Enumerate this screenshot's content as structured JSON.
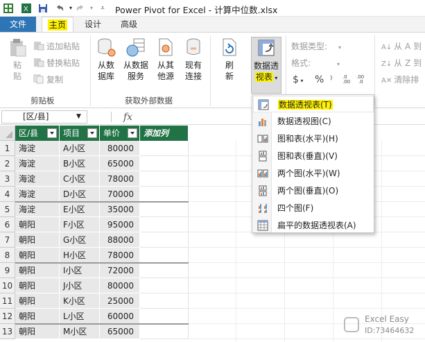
{
  "window": {
    "title": "Power Pivot for Excel - 计算中位数.xlsx"
  },
  "ribbon_tabs": [
    {
      "label": "文件"
    },
    {
      "label": "主页"
    },
    {
      "label": "设计"
    },
    {
      "label": "高级"
    }
  ],
  "clipboard_group": {
    "paste_line1": "粘",
    "paste_line2": "贴",
    "append_paste": "追加粘贴",
    "replace_paste": "替换粘贴",
    "copy": "复制",
    "label": "剪贴板"
  },
  "external_data_group": {
    "from_database_1": "从数",
    "from_database_2": "据库",
    "from_service_1": "从数据",
    "from_service_2": "服务",
    "from_other_1": "从其",
    "from_other_2": "他源",
    "existing_1": "现有",
    "existing_2": "连接",
    "label": "获取外部数据"
  },
  "refresh": {
    "line1": "刷",
    "line2": "新"
  },
  "pivot_button": {
    "line1": "数据透",
    "line2": "视表"
  },
  "format_group": {
    "data_type": "数据类型:",
    "format": "格式:",
    "currency": "$",
    "percent": "%",
    "comma": "⁾"
  },
  "sort_group": {
    "sort_az": "从 A 到",
    "sort_za": "从 Z 到",
    "clear_sort": "清除排"
  },
  "formula_bar": {
    "name_box": "[区/县]",
    "fx": "fx"
  },
  "table": {
    "headers": [
      "区/县",
      "项目",
      "单价",
      "添加列"
    ],
    "rows": [
      [
        "海淀",
        "A小区",
        "80000"
      ],
      [
        "海淀",
        "B小区",
        "65000"
      ],
      [
        "海淀",
        "C小区",
        "78000"
      ],
      [
        "海淀",
        "D小区",
        "70000"
      ],
      [
        "海淀",
        "E小区",
        "35000"
      ],
      [
        "朝阳",
        "F小区",
        "95000"
      ],
      [
        "朝阳",
        "G小区",
        "88000"
      ],
      [
        "朝阳",
        "H小区",
        "78000"
      ],
      [
        "朝阳",
        "I小区",
        "72000"
      ],
      [
        "朝阳",
        "J小区",
        "80000"
      ],
      [
        "朝阳",
        "K小区",
        "25000"
      ],
      [
        "朝阳",
        "L小区",
        "60000"
      ],
      [
        "朝阳",
        "M小区",
        "65000"
      ]
    ],
    "row_numbers": [
      "1",
      "2",
      "3",
      "4",
      "5",
      "6",
      "7",
      "8",
      "9",
      "10",
      "11",
      "12",
      "13"
    ]
  },
  "pivot_menu": {
    "items": [
      {
        "label": "数据透视表(T)",
        "icon": "pivot-table-icon"
      },
      {
        "label": "数据透视图(C)",
        "icon": "pivot-chart-icon"
      },
      {
        "label": "图和表(水平)(H)",
        "icon": "chart-table-horizontal-icon"
      },
      {
        "label": "图和表(垂直)(V)",
        "icon": "chart-table-vertical-icon"
      },
      {
        "label": "两个图(水平)(W)",
        "icon": "two-charts-horizontal-icon"
      },
      {
        "label": "两个图(垂直)(O)",
        "icon": "two-charts-vertical-icon"
      },
      {
        "label": "四个图(F)",
        "icon": "four-charts-icon"
      },
      {
        "label": "扁平的数据透视表(A)",
        "icon": "flat-pivot-table-icon"
      }
    ]
  },
  "watermark": {
    "name": "Excel Easy",
    "id": "ID:73464632"
  },
  "colors": {
    "file_tab": "#2e75b6",
    "header_green": "#217346",
    "highlight": "#fff200"
  }
}
